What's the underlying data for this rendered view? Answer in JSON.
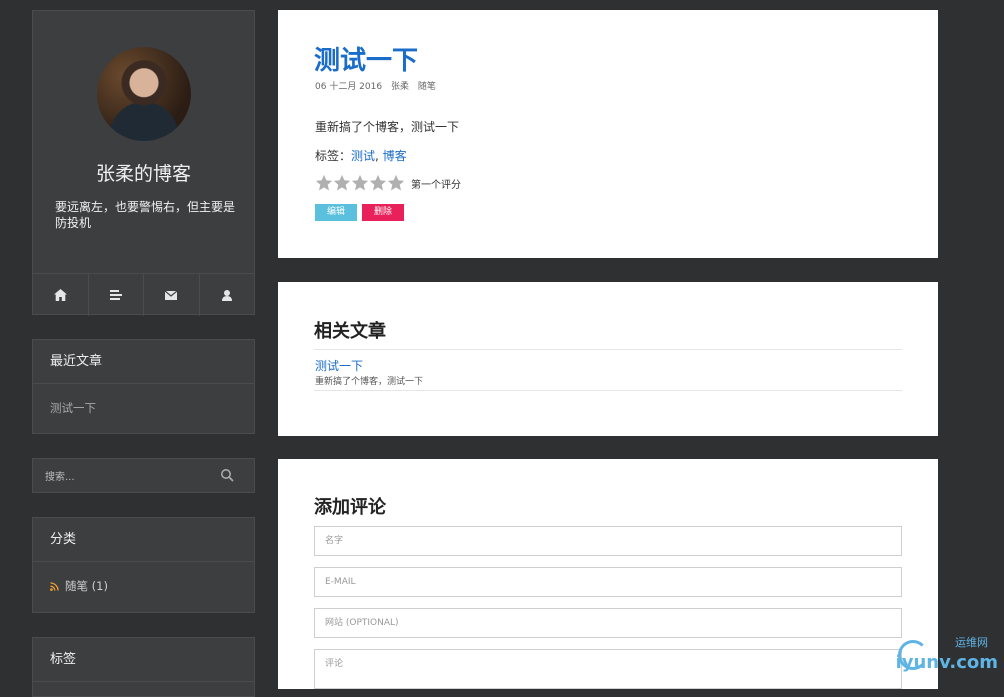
{
  "sidebar": {
    "blog_title": "张柔的博客",
    "blog_desc": "要远离左，也要警惕右，但主要是防投机",
    "nav_icons": [
      "home-icon",
      "list-icon",
      "envelope-icon",
      "user-icon"
    ],
    "recent": {
      "title": "最近文章",
      "items": [
        "测试一下"
      ]
    },
    "search": {
      "placeholder": "搜索..."
    },
    "categories": {
      "title": "分类",
      "items": [
        {
          "label": "随笔 (1)"
        }
      ]
    },
    "tags": {
      "title": "标签"
    }
  },
  "post": {
    "title": "测试一下",
    "date": "06 十二月 2016",
    "author": "张柔",
    "category": "随笔",
    "excerpt": "重新搞了个博客，测试一下",
    "tags_label": "标签：",
    "tags": [
      "测试",
      "博客"
    ],
    "tag_separator": ", ",
    "rating": {
      "stars": 5,
      "filled": 0,
      "text": "第一个评分"
    },
    "edit_label": "编辑",
    "delete_label": "删除"
  },
  "related": {
    "title": "相关文章",
    "items": [
      {
        "title": "测试一下",
        "excerpt": "重新搞了个博客，测试一下"
      }
    ]
  },
  "comments": {
    "title": "添加评论",
    "name_placeholder": "名字",
    "email_placeholder": "E-MAIL",
    "site_placeholder": "网站 (OPTIONAL)",
    "comment_placeholder": "评论"
  },
  "watermark": {
    "top": "运维网",
    "bottom": "iyunv.com"
  },
  "colors": {
    "background": "#2f3032",
    "panel": "#3d3e40",
    "link": "#1a6dc9",
    "edit_button": "#5bc0de",
    "delete_button": "#e8215a",
    "star": "#b0b0b0",
    "rss": "#f0a030"
  }
}
